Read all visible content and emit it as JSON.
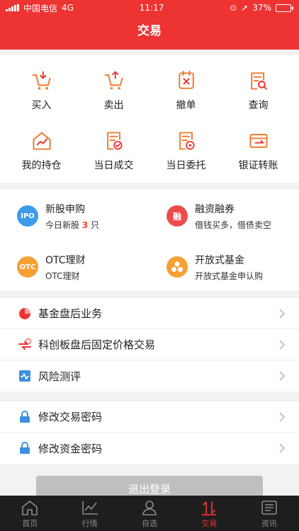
{
  "status": {
    "carrier": "中国电信",
    "network": "4G",
    "time": "11:17",
    "battery": "37%",
    "battery_level": 0.37
  },
  "header": {
    "title": "交易"
  },
  "quick_actions": [
    {
      "label": "买入",
      "icon": "cart-in-icon"
    },
    {
      "label": "卖出",
      "icon": "cart-out-icon"
    },
    {
      "label": "撤单",
      "icon": "cancel-order-icon"
    },
    {
      "label": "查询",
      "icon": "search-doc-icon"
    },
    {
      "label": "我的持仓",
      "icon": "portfolio-icon"
    },
    {
      "label": "当日成交",
      "icon": "today-deal-icon"
    },
    {
      "label": "当日委托",
      "icon": "today-entrust-icon"
    },
    {
      "label": "银证转账",
      "icon": "transfer-icon"
    }
  ],
  "services": [
    {
      "title": "新股申购",
      "subtitle_prefix": "今日新股",
      "count": "3",
      "subtitle_suffix": "只",
      "badge": "IPO",
      "color": "#3d9be9"
    },
    {
      "title": "融资融券",
      "subtitle": "借钱买多，借债卖空",
      "badge": "融",
      "color": "#ee4b4b"
    },
    {
      "title": "OTC理财",
      "subtitle": "OTC理财",
      "badge": "OTC",
      "color": "#f5a033"
    },
    {
      "title": "开放式基金",
      "subtitle": "开放式基金申认购",
      "badge": "fund",
      "color": "#f5a033"
    }
  ],
  "list1": [
    {
      "label": "基金盘后业务",
      "icon": "pie-chart-icon"
    },
    {
      "label": "科创板盘后固定价格交易",
      "icon": "star-board-icon"
    },
    {
      "label": "风险测评",
      "icon": "risk-test-icon"
    }
  ],
  "list2": [
    {
      "label": "修改交易密码",
      "icon": "lock-icon"
    },
    {
      "label": "修改资金密码",
      "icon": "lock-icon"
    }
  ],
  "logout": {
    "label": "退出登录"
  },
  "tabs": [
    {
      "label": "首页",
      "icon": "home-icon"
    },
    {
      "label": "行情",
      "icon": "chart-icon"
    },
    {
      "label": "自选",
      "icon": "user-icon"
    },
    {
      "label": "交易",
      "icon": "trade-icon"
    },
    {
      "label": "资讯",
      "icon": "news-icon"
    }
  ],
  "colors": {
    "brand": "#ee3333",
    "orange": "#f07a2e"
  }
}
